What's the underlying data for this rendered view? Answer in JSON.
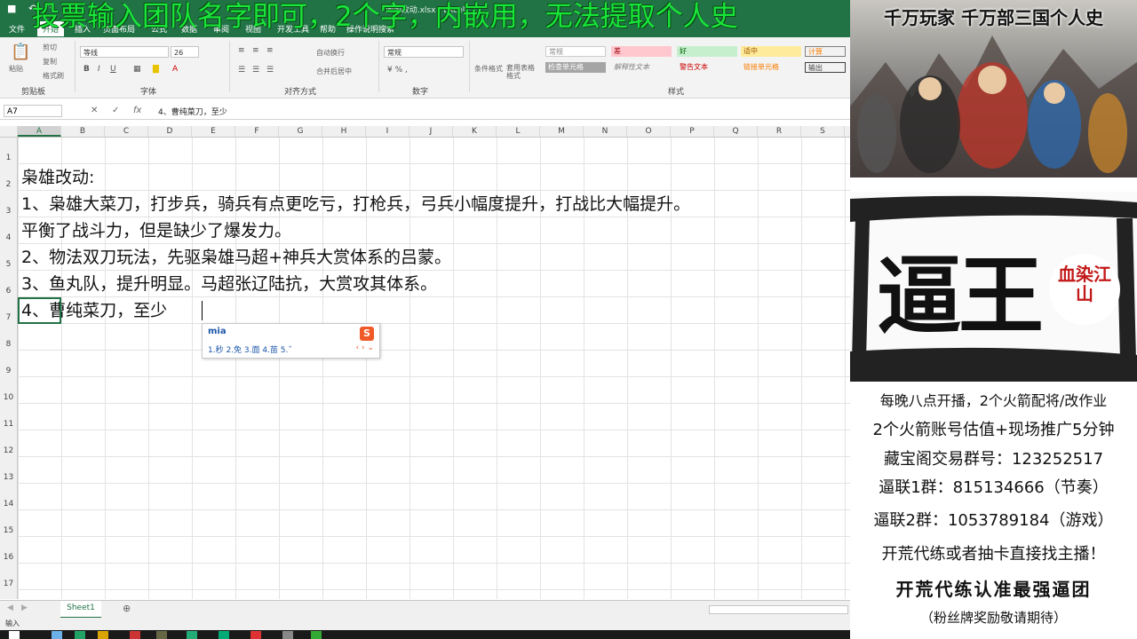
{
  "window": {
    "title": "地图改动.xlsx - Excel",
    "quick_access": [
      "save",
      "undo",
      "redo"
    ]
  },
  "menu": {
    "items": [
      "文件",
      "开始",
      "插入",
      "页面布局",
      "公式",
      "数据",
      "审阅",
      "视图",
      "开发工具",
      "帮助",
      "操作说明搜索"
    ],
    "active_index": 1
  },
  "ribbon": {
    "clipboard": {
      "paste": "粘贴",
      "cut": "剪切",
      "copy": "复制",
      "format_painter": "格式刷",
      "group": "剪贴板"
    },
    "font": {
      "name": "等线",
      "size": "26",
      "bold": "B",
      "italic": "I",
      "underline": "U",
      "group": "字体"
    },
    "alignment": {
      "wrap": "自动换行",
      "merge": "合并后居中",
      "group": "对齐方式"
    },
    "number": {
      "format": "常规",
      "group": "数字"
    },
    "styles": {
      "conditional": "条件格式",
      "table": "套用表格格式",
      "cells": [
        "常规",
        "差",
        "好",
        "适中",
        "计算",
        "检查单元格",
        "解释性文本",
        "警告文本",
        "链接单元格",
        "输出"
      ],
      "group": "样式"
    }
  },
  "formula_bar": {
    "name_box": "A7",
    "content": "4、曹纯菜刀，至少"
  },
  "columns": [
    "A",
    "B",
    "C",
    "D",
    "E",
    "F",
    "G",
    "H",
    "I",
    "J",
    "K",
    "L",
    "M",
    "N",
    "O",
    "P",
    "Q",
    "R",
    "S"
  ],
  "selected_column": "A",
  "rows": [
    "1",
    "2",
    "3",
    "4",
    "5",
    "6",
    "7",
    "8",
    "9",
    "10",
    "11",
    "12",
    "13",
    "14",
    "15",
    "16",
    "17"
  ],
  "cells": [
    "枭雄改动:",
    "1、枭雄大菜刀，打步兵，骑兵有点更吃亏，打枪兵，弓兵小幅度提升，打战比大幅提升。",
    "平衡了战斗力，但是缺少了爆发力。",
    "2、物法双刀玩法，先驱枭雄马超+神兵大赏体系的吕蒙。",
    "3、鱼丸队，提升明显。马超张辽陆抗，大赏攻其体系。",
    "4、曹纯菜刀，至少"
  ],
  "ime": {
    "input": "mia",
    "candidates": "1.秒  2.免  3.面  4.苗  5.ˇ",
    "logo": "S"
  },
  "sheet_tabs": [
    "Sheet1"
  ],
  "status": "输入",
  "overlay_banner": "投票输入团队名字即可，2个字，内嵌用，无法提取个人史",
  "side_panel": {
    "art1_title": "千万玩家 千万部三国个人史",
    "art2_text": "逼王",
    "seal_text": "血染江山",
    "info_lines": [
      "每晚八点开播，2个火箭配将/改作业",
      "2个火箭账号估值+现场推广5分钟",
      "藏宝阁交易群号：123252517",
      "逼联1群：815134666（节奏）",
      "逼联2群：1053789184（游戏）",
      "开荒代练或者抽卡直接找主播！",
      "开荒代练认准最强逼团",
      "（粉丝牌奖励敬请期待）"
    ]
  },
  "colors": {
    "excel_green": "#217346",
    "overlay_green": "#19e63b",
    "seal_red": "#c21818"
  }
}
